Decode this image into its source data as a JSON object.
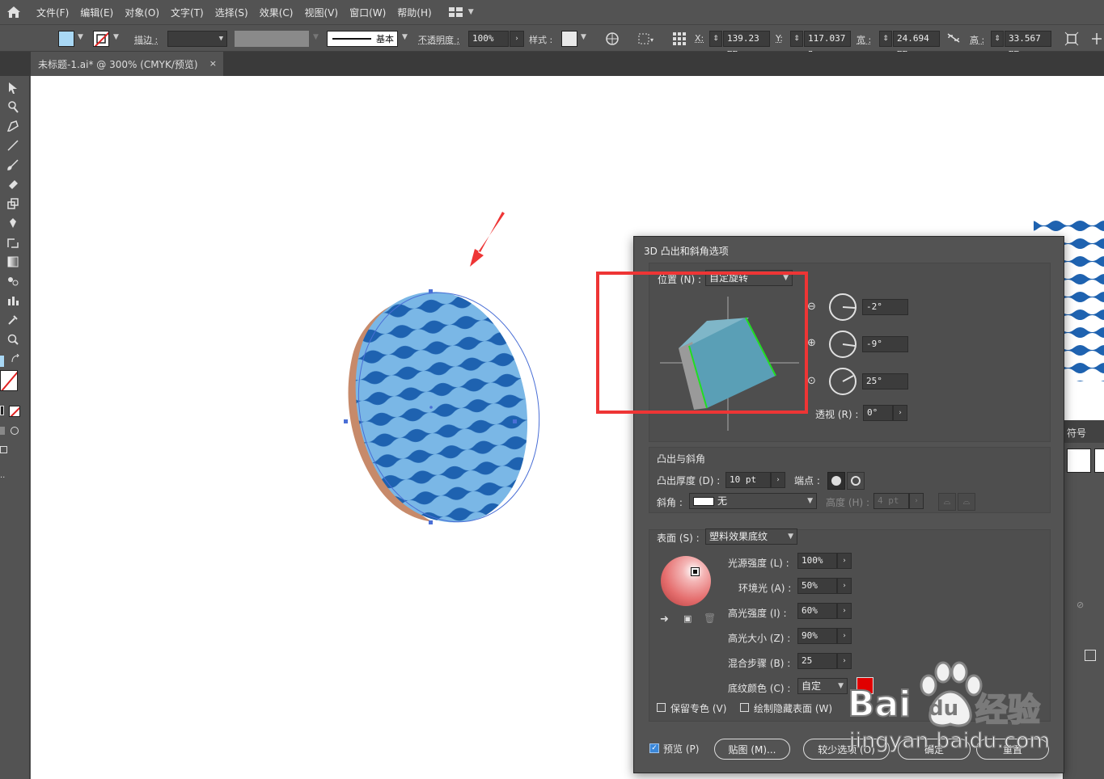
{
  "menubar": {
    "items": [
      "文件(F)",
      "编辑(E)",
      "对象(O)",
      "文字(T)",
      "选择(S)",
      "效果(C)",
      "视图(V)",
      "窗口(W)",
      "帮助(H)"
    ]
  },
  "controlbar": {
    "stroke_label": "描边 :",
    "stroke_style": "基本",
    "opacity_label": "不透明度 :",
    "opacity_value": "100%",
    "style_label": "样式 :",
    "x_label": "X:",
    "x_value": "139.23 mm",
    "y_label": "Y:",
    "y_value": "117.037 n",
    "w_label": "宽 :",
    "w_value": "24.694 mm",
    "h_label": "高 :",
    "h_value": "33.567 mm",
    "colors": {
      "fill": "#a9d8f5",
      "stroke_slash": "#e02020"
    }
  },
  "tab": {
    "title": "未标题-1.ai* @ 300% (CMYK/预览)",
    "close": "×"
  },
  "dialog": {
    "title": "3D 凸出和斜角选项",
    "position_label": "位置 (N) :",
    "position_value": "自定旋转",
    "rotation_x": "-2°",
    "rotation_y": "-9°",
    "rotation_z": "25°",
    "perspective_label": "透视 (R) :",
    "perspective_value": "0°",
    "extrude_section": "凸出与斜角",
    "extrude_depth_label": "凸出厚度 (D) :",
    "extrude_depth_value": "10 pt",
    "cap_label": "端点 :",
    "bevel_label": "斜角 :",
    "bevel_value": "无",
    "height_label": "高度 (H) :",
    "height_value": "4 pt",
    "surface_label": "表面 (S) :",
    "surface_value": "塑料效果底纹",
    "light_intensity_label": "光源强度 (L) :",
    "light_intensity_value": "100%",
    "ambient_label": "环境光 (A) :",
    "ambient_value": "50%",
    "highlight_intensity_label": "高光强度 (I) :",
    "highlight_intensity_value": "60%",
    "highlight_size_label": "高光大小 (Z) :",
    "highlight_size_value": "90%",
    "blend_steps_label": "混合步骤 (B) :",
    "blend_steps_value": "25",
    "shading_color_label": "底纹颜色 (C) :",
    "shading_color_value": "自定",
    "shading_color_swatch": "#e00000",
    "preserve_spot_label": "保留专色 (V)",
    "draw_hidden_label": "绘制隐藏表面 (W)",
    "preview_label": "预览 (P)",
    "map_button": "贴图 (M)...",
    "fewer_options_button": "较少选项 (O)",
    "ok_button": "确定",
    "reset_button": "重置"
  },
  "side_panel": {
    "tab_label": "符号"
  },
  "watermark": {
    "brand": "Bai",
    "brand_du": "du",
    "brand_cn": "经验",
    "url": "jingyan.baidu.com"
  },
  "colors": {
    "annotation_red": "#ee3535",
    "wave_dark": "#1e62b0",
    "wave_light": "#7ab7e6",
    "cube_face": "#5a9fb6",
    "cube_edge": "#22dd22"
  }
}
